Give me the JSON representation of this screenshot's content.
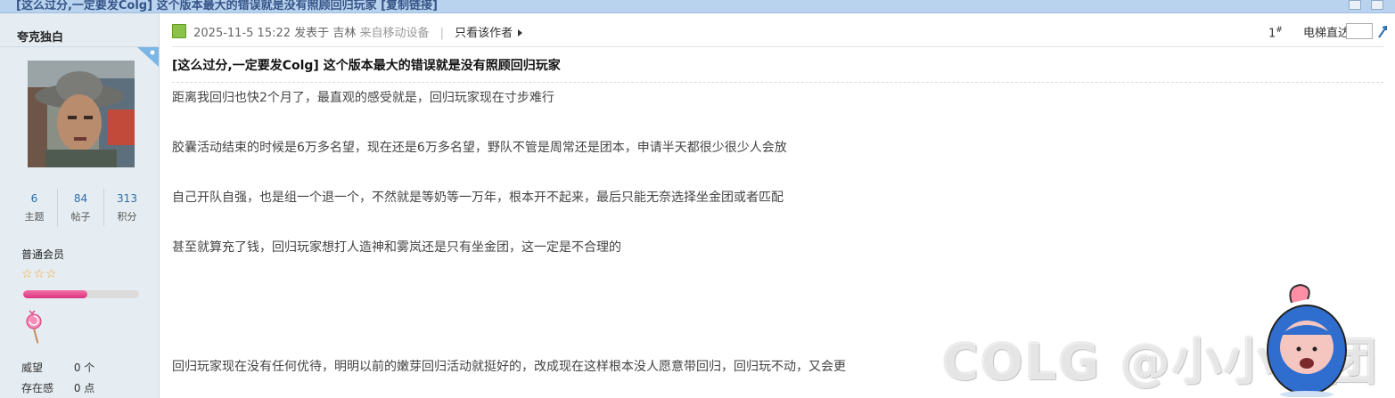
{
  "window": {
    "title_fragment": "[这么过分,一定要发Colg] 这个版本最大的错误就是没有照顾回归玩家 [复制链接]"
  },
  "author": {
    "name": "夸克独白",
    "stats": [
      {
        "value": "6",
        "label": "主题"
      },
      {
        "value": "84",
        "label": "帖子"
      },
      {
        "value": "313",
        "label": "积分"
      }
    ],
    "group": "普通会员",
    "stars": "☆☆☆",
    "level_progress": 0.55,
    "fields": [
      {
        "key": "威望",
        "value": "0 个"
      },
      {
        "key": "存在感",
        "value": "0 点"
      }
    ]
  },
  "post": {
    "datetime": "2025-11-5 15:22",
    "posted_in": "发表于",
    "location": "吉林",
    "via": "来自移动设备",
    "only_author": "只看该作者",
    "floor": "1",
    "floor_mark": "#",
    "jump_label": "电梯直达",
    "title": "[这么过分,一定要发Colg] 这个版本最大的错误就是没有照顾回归玩家",
    "paragraphs": [
      "距离我回归也快2个月了，最直观的感受就是，回归玩家现在寸步难行",
      "胶囊活动结束的时候是6万多名望，现在还是6万多名望，野队不管是周常还是团本，申请半天都很少很少人会放",
      "自己开队自强，也是组一个退一个，不然就是等奶等一万年，根本开不起来，最后只能无奈选择坐金团或者匹配",
      "甚至就算充了钱，回归玩家想打人造神和雾岚还是只有坐金团，这一定是不合理的",
      "回归玩家现在没有任何优待，明明以前的嫩芽回归活动就挺好的，改成现在这样根本没人愿意带回归，回归玩不动，又会更"
    ],
    "watermark": "COLG @小小战团"
  },
  "colors": {
    "sidebar_bg": "#e5edf2",
    "link_blue": "#2b6daa",
    "progress_pink": "#e0488a",
    "star_gold": "#f5a623"
  }
}
